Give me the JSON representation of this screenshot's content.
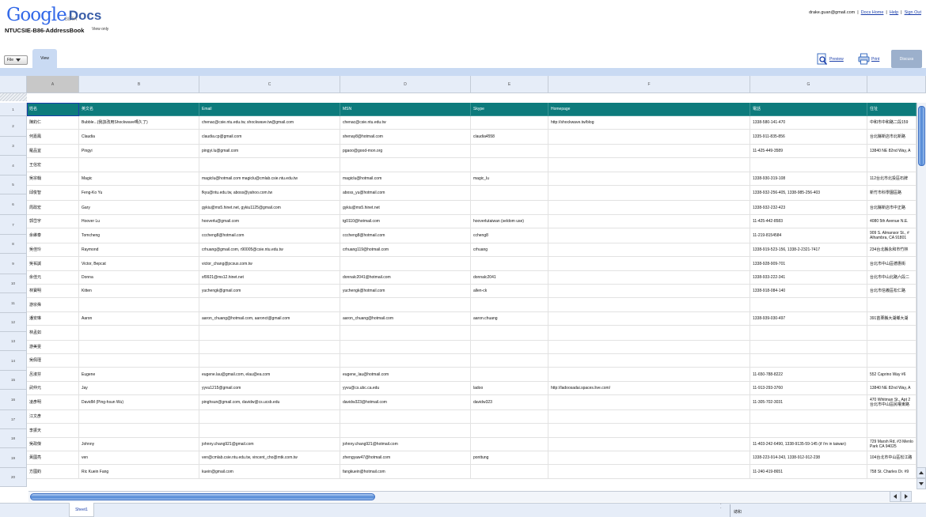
{
  "header": {
    "logo_google": "Google",
    "logo_docs": "Docs",
    "beta": "BETA",
    "doc_title": "NTUCSIE-B86-AddressBook",
    "view_only": "View only",
    "user_email": "drake.guan@gmail.com",
    "links": [
      "Docs Home",
      "Help",
      "Sign Out"
    ],
    "separator": "|"
  },
  "toolbar": {
    "file_menu": "File",
    "view_tab": "View",
    "preview": "Preview",
    "print": "Print",
    "discuss": "Discuss"
  },
  "sheet": {
    "columns": [
      "A",
      "B",
      "C",
      "D",
      "E",
      "F",
      "G",
      ""
    ],
    "row_numbers": [
      "1",
      "2",
      "3",
      "4",
      "5",
      "6",
      "7",
      "8",
      "9",
      "10",
      "11",
      "12",
      "13",
      "14",
      "15",
      "16",
      "17",
      "18",
      "19",
      "20"
    ],
    "header_row": [
      "姓名",
      "英文名",
      "Email",
      "MSN",
      "Skype",
      "Homepage",
      "電話",
      "住址"
    ],
    "rows": [
      [
        "陳鈞仁",
        "Bubble...(我該改用Shockwave嗎久了)",
        "chenac@csie.ntu.edu.tw, shockwave.tw@gmail.com",
        "chenac@csie.ntu.edu.tw",
        "",
        "http://shockwave.tw/blog",
        "1338-580-141-470",
        "中和市中和路二段159"
      ],
      [
        "何嘉鳳",
        "Claudia",
        "claudia.cp@gmail.com",
        "shenay8@hotmail.com",
        "claudia4558",
        "",
        "1335-911-835-856",
        "台北縣新店市北新路"
      ],
      [
        "羅品宜",
        "Pingyi",
        "pingyi.lu@gmail.com",
        "pgaoo@good-mon.org",
        "",
        "",
        "11-425-449-3589",
        "13840 NE 82nd Way, A"
      ],
      [
        "王信宏",
        "",
        "",
        "",
        "",
        "",
        "",
        ""
      ],
      [
        "吳宗翰",
        "Magic",
        "magiclu@hotmail.com magiclu@cmlab.csie.ntu.edu.tw",
        "magiclu@hotmail.com",
        "magic_lu",
        "",
        "1338-930-319-108",
        "112台北市北投區石牌"
      ],
      [
        "邱俊智",
        "Feng-Ko Yu",
        "fkyu@ntu.edu.tw, aboss@yahoo.com.tw",
        "aboss_yu@hotmail.com",
        "",
        "",
        "1338-932-256-405, 1338-985-256-403",
        "新竹市科學園區路"
      ],
      [
        "周政宏",
        "Gary",
        "gykiu@ms5.hinet.net, gykiu1125@gmail.com",
        "gykiu@ms5.hinet.net",
        "",
        "",
        "1338-932-232-423",
        "台北縣新店市中正路"
      ],
      [
        "郭岱宇",
        "Hoover Lu",
        "hooverlu@gmail.com",
        "tg0110@hotmail.com",
        "hooverlutaiwan (seldom use)",
        "",
        "11-425-442-8583",
        "4080 5th Avenue N.E."
      ],
      [
        "余維泰",
        "Tomcheng",
        "cccheng8@hotmail.com",
        "cccheng8@hotmail.com",
        "ccheng8",
        "",
        "11-219-8154584",
        "909 S. Almansor St., #\nAlhambra, CA 91801"
      ],
      [
        "吳佳玲",
        "Raymond",
        "crhuang@gmail.com, r90005@csie.ntu.edu.tw",
        "crhuang119@hotmail.com",
        "crhuang",
        "",
        "1338-919-523-156, 1338-2-2321-7417",
        "234台北縣永和市竹林"
      ],
      [
        "吳祐誠",
        "Victor, Bepcat",
        "victor_chang@pcsus.com.tw",
        "",
        "",
        "",
        "1338-928-909-701",
        "台北市中山區德惠街"
      ],
      [
        "余佳元",
        "Donna",
        "sf9921@ms12.hinet.net",
        "donnalc2041@hotmail.com",
        "donnalc2041",
        "",
        "1338-933-222-341",
        "台北市中山北路六段二"
      ],
      [
        "林寶明",
        "Kitten",
        "yuchengk@gmail.com",
        "yuchengk@hotmail.com",
        "allen-ck",
        "",
        "1338-918-084-140",
        "台北市信義區松仁路"
      ],
      [
        "游宗舜",
        "",
        "",
        "",
        "",
        "",
        "",
        ""
      ],
      [
        "潘安琳",
        "Aaron",
        "aaron_chuang@hotmail.com, aaronct@gmail.com",
        "aaron_chuang@hotmail.com",
        "aaron.chuang",
        "",
        "1338-939-030-497",
        "391苗栗縣大湖鄉大湖"
      ],
      [
        "林孟如",
        "",
        "",
        "",
        "",
        "",
        "",
        ""
      ],
      [
        "游美雯",
        "",
        "",
        "",
        "",
        "",
        "",
        ""
      ],
      [
        "吳佩瑾",
        "",
        "",
        "",
        "",
        "",
        "",
        ""
      ],
      [
        "呂淑芬",
        "Eugene",
        "eugene.lau@gmail.com, elau@ea.com",
        "eugene_lau@hotmail.com",
        "",
        "",
        "11-650-788-8222",
        "552 Caprino Way #6"
      ],
      [
        "武仲元",
        "Jay",
        "yyvu1215@gmail.com",
        "yyvu@cs.ubc.ca.edu",
        "ladoo",
        "http://ladoosadai.spaces.live.com/",
        "11-913-293-3760",
        "13840 NE 82nd Way, A"
      ],
      [
        "凌彥明",
        "DavidM (Ping-hsun Wu)",
        "pinghsun@gmail.com, davidw@cs.ucsb.edu",
        "davidw323@hotmail.com",
        "davidw323",
        "",
        "11-305-702-3031",
        "470 Whitman St., Apt 2\n台北市中山區民權東路"
      ],
      [
        "江文彥",
        "",
        "",
        "",
        "",
        "",
        "",
        ""
      ],
      [
        "李振天",
        "",
        "",
        "",
        "",
        "",
        "",
        ""
      ],
      [
        "吳政傑",
        "Johnny",
        "johnny.chang921@gmail.com",
        "johnny.chang921@hotmail.com",
        "",
        "",
        "11-403-242-6490, 1338-9135-59-145 (if i'm in taiwan)",
        "729 Marsh Rd, #3\nMenlo Park CA 94025"
      ],
      [
        "黃國亮",
        "ven",
        "ven@cmlab.csie.ntu.edu.tw, vincent_cho@mtk.com.tw",
        "zhengyaw47@hotmail.com",
        "ponttung",
        "",
        "1338-223-914-343, 1338-912-912-238",
        "104台北市中山區松江路"
      ],
      [
        "方國鈞",
        "Ric Kuein Fang",
        "kuein@gmail.com",
        "fangkuein@hotmail.com",
        "",
        "",
        "11-240-419-8651",
        "758 St. Charles Dr. #9"
      ]
    ]
  },
  "bottom": {
    "sheet_tab": "Sheet1",
    "sum_label": "總和"
  }
}
